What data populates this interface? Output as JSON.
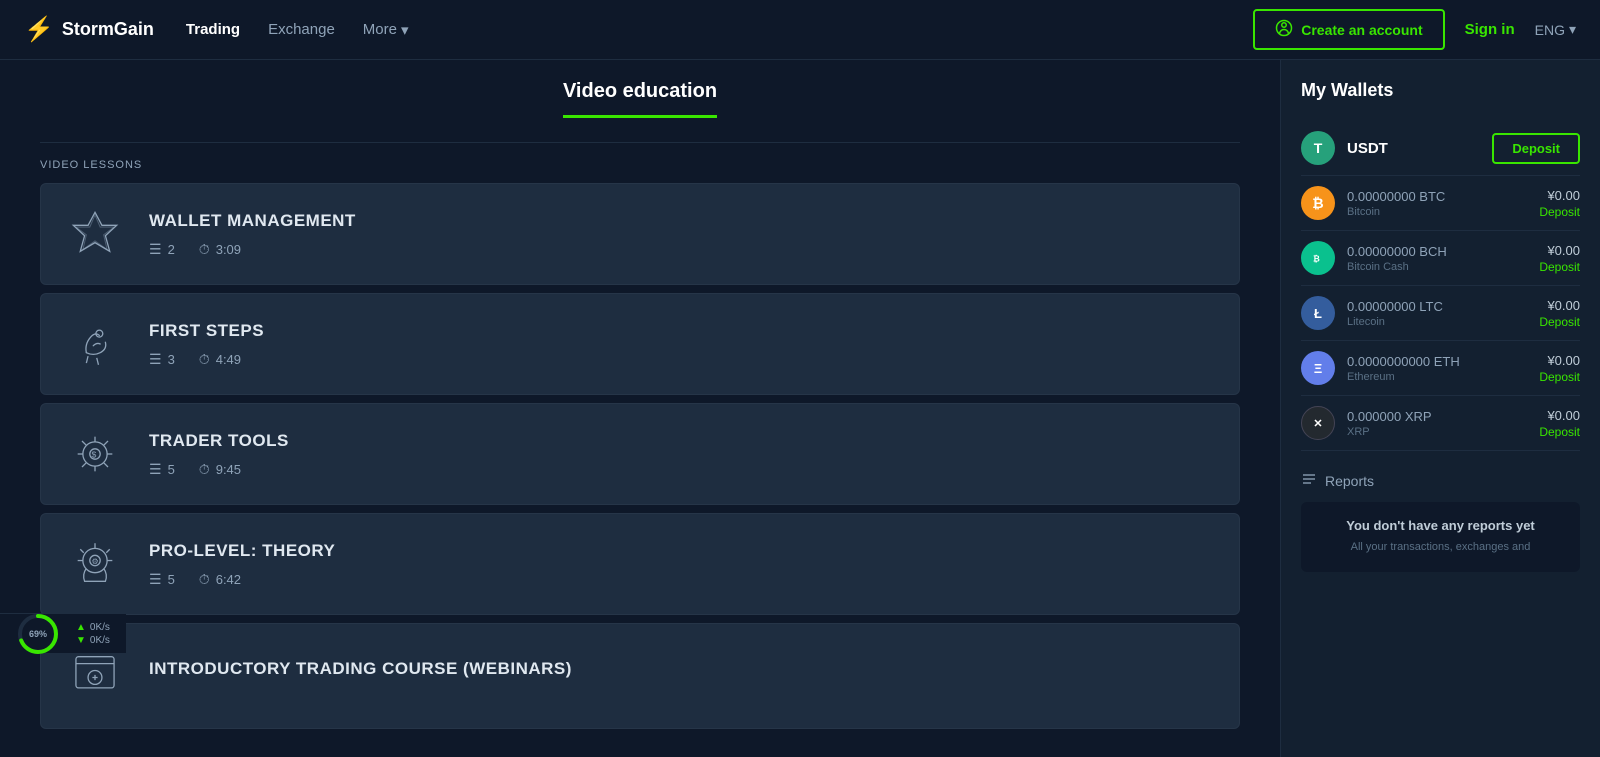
{
  "header": {
    "logo_text": "StormGain",
    "logo_icon": "⚡",
    "nav": [
      {
        "label": "Trading",
        "active": true
      },
      {
        "label": "Exchange",
        "active": false
      },
      {
        "label": "More",
        "active": false,
        "has_dropdown": true
      }
    ],
    "create_account_label": "Create an account",
    "sign_in_label": "Sign in",
    "lang_label": "ENG"
  },
  "page": {
    "title": "Video education"
  },
  "lessons": {
    "section_label": "VIDEO LESSONS",
    "items": [
      {
        "title": "WALLET MANAGEMENT",
        "icon_type": "stars",
        "lesson_count": "2",
        "duration": "3:09"
      },
      {
        "title": "FIRST STEPS",
        "icon_type": "hand",
        "lesson_count": "3",
        "duration": "4:49"
      },
      {
        "title": "TRADER TOOLS",
        "icon_type": "gear-dollar",
        "lesson_count": "5",
        "duration": "9:45"
      },
      {
        "title": "PRO-LEVEL: THEORY",
        "icon_type": "brain-gear",
        "lesson_count": "5",
        "duration": "6:42"
      },
      {
        "title": "INTRODUCTORY TRADING COURSE (WEBINARS)",
        "icon_type": "chart",
        "lesson_count": "",
        "duration": ""
      }
    ]
  },
  "sidebar": {
    "title": "My Wallets",
    "deposit_button": "Deposit",
    "wallets": [
      {
        "coin": "USDT",
        "coin_name": "",
        "amount": "",
        "deposit_label": "Deposit",
        "is_main": true
      },
      {
        "coin": "BTC",
        "coin_name": "Bitcoin",
        "amount": "0.00000000 BTC",
        "balance": "¥0.00",
        "deposit_label": "Deposit"
      },
      {
        "coin": "BCH",
        "coin_name": "Bitcoin Cash",
        "amount": "0.00000000 BCH",
        "balance": "¥0.00",
        "deposit_label": "Deposit"
      },
      {
        "coin": "LTC",
        "coin_name": "Litecoin",
        "amount": "0.00000000 LTC",
        "balance": "¥0.00",
        "deposit_label": "Deposit"
      },
      {
        "coin": "ETH",
        "coin_name": "Ethereum",
        "amount": "0.0000000000 ETH",
        "balance": "¥0.00",
        "deposit_label": "Deposit"
      },
      {
        "coin": "XRP",
        "coin_name": "XRP",
        "amount": "0.000000 XRP",
        "balance": "¥0.00",
        "deposit_label": "Deposit"
      }
    ],
    "reports": {
      "label": "Reports",
      "empty_title": "You don't have any reports yet",
      "empty_desc": "All your transactions, exchanges and"
    }
  },
  "status_bar": {
    "gauge_percent": "69",
    "gauge_label": "69%",
    "upload_speed": "0K/s",
    "download_speed": "0K/s"
  }
}
